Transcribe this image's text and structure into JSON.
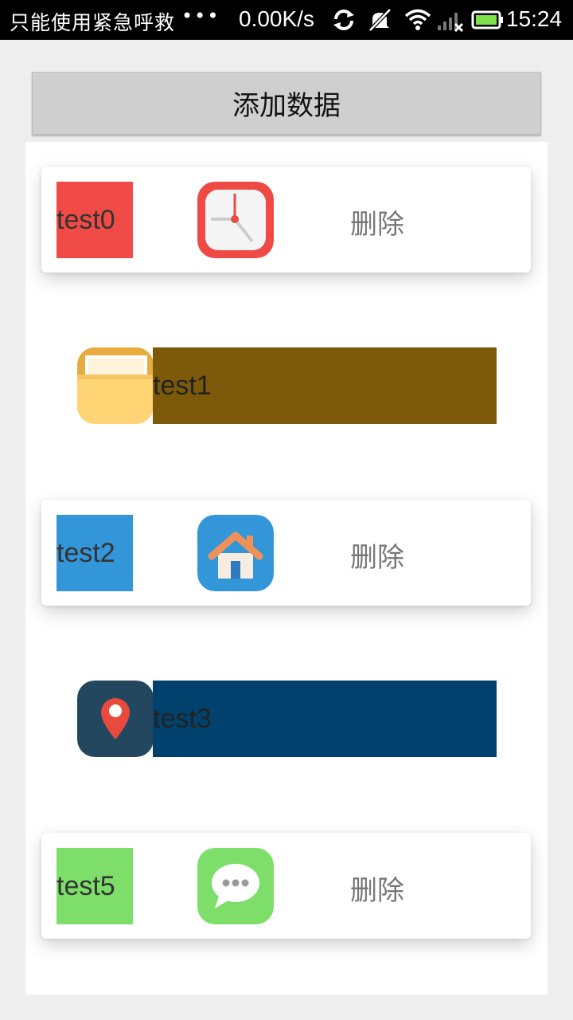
{
  "status_bar": {
    "carrier": "只能使用紧急呼救",
    "dots": "•••",
    "speed": "0.00K/s",
    "time": "15:24",
    "icons": [
      "sync-icon",
      "mute-icon",
      "wifi-icon",
      "signal-icon",
      "battery-icon"
    ]
  },
  "add_button": {
    "label": "添加数据"
  },
  "list": {
    "items": [
      {
        "label": "test0",
        "color": "#f04b46",
        "icon": "clock-icon",
        "delete_label": "删除"
      },
      {
        "label": "test1",
        "color": "#7d5a09",
        "icon": "folder-icon"
      },
      {
        "label": "test2",
        "color": "#3396d8",
        "icon": "home-icon",
        "delete_label": "删除"
      },
      {
        "label": "test3",
        "color": "#00426d",
        "icon": "location-pin-icon"
      },
      {
        "label": "test5",
        "color": "#7ddf6a",
        "icon": "chat-bubble-icon",
        "delete_label": "删除"
      }
    ]
  }
}
